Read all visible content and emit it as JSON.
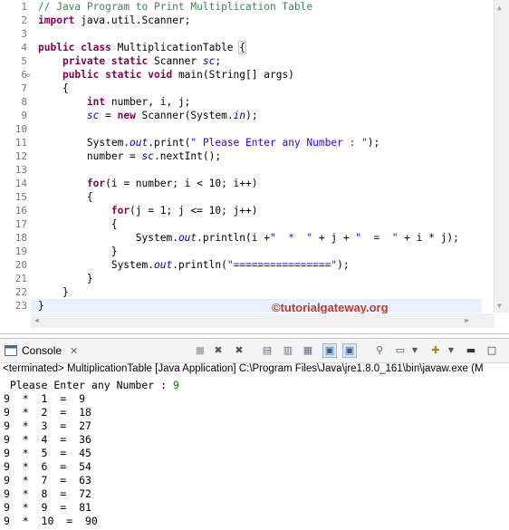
{
  "editor": {
    "line_numbers": [
      "1",
      "2",
      "3",
      "4",
      "5",
      "6",
      "7",
      "8",
      "9",
      "10",
      "11",
      "12",
      "13",
      "14",
      "15",
      "16",
      "17",
      "18",
      "19",
      "20",
      "21",
      "22",
      "23"
    ],
    "code": {
      "l1_comment": "// Java Program to Print Multiplication Table",
      "l2_kw": "import",
      "l2_rest": " java.util.Scanner;",
      "l4_kw": "public class",
      "l4_name": " MultiplicationTable ",
      "l4_brace": "{",
      "l5_kw": "private static",
      "l5_type": " Scanner ",
      "l5_field": "sc",
      "l5_end": ";",
      "l6_kw": "public static void",
      "l6_rest": " main(String[] args)",
      "l7": "{",
      "l8_kw": "int",
      "l8_rest": " number, i, j;",
      "l9_field": "sc",
      "l9_mid": " = ",
      "l9_kw": "new",
      "l9_a": " Scanner(System.",
      "l9_in": "in",
      "l9_b": ");",
      "l11_a": "System.",
      "l11_out": "out",
      "l11_b": ".print(",
      "l11_str": "\" Please Enter any Number : \"",
      "l11_c": ");",
      "l12_a": "number = ",
      "l12_field": "sc",
      "l12_b": ".nextInt();",
      "l14_kw": "for",
      "l14_rest": "(i = number; i < 10; i++)",
      "l15": "{",
      "l16_kw": "for",
      "l16_rest": "(j = 1; j <= 10; j++)",
      "l17": "{",
      "l18_a": "System.",
      "l18_out": "out",
      "l18_b": ".println(i +",
      "l18_s1": "\"  *  \"",
      "l18_c": " + j + ",
      "l18_s2": "\"  =  \"",
      "l18_d": " + i * j);",
      "l19": "}",
      "l20_a": "System.",
      "l20_out": "out",
      "l20_b": ".println(",
      "l20_str": "\"================\"",
      "l20_c": ");",
      "l21": "}",
      "l22": "}",
      "l23": "}"
    },
    "watermark": "©tutorialgateway.org"
  },
  "console": {
    "tab_label": "Console",
    "close_glyph": "✕",
    "status": "<terminated> MultiplicationTable [Java Application] C:\\Program Files\\Java\\jre1.8.0_161\\bin\\javaw.exe (M",
    "prompt": " Please Enter any Number : ",
    "input": "9",
    "output_lines": [
      "9  *  1  =  9",
      "9  *  2  =  18",
      "9  *  3  =  27",
      "9  *  4  =  36",
      "9  *  5  =  45",
      "9  *  6  =  54",
      "9  *  7  =  63",
      "9  *  8  =  72",
      "9  *  9  =  81",
      "9  *  10  =  90"
    ]
  },
  "toolbar": {
    "icons": [
      "terminate-icon",
      "remove-launch-icon",
      "remove-all-icon",
      "clear-console-icon",
      "scroll-lock-icon",
      "word-wrap-icon",
      "show-on-stdout-icon",
      "show-on-stderr-icon",
      "pin-console-icon",
      "display-console-icon",
      "open-console-icon",
      "minimize-icon",
      "maximize-icon"
    ]
  }
}
